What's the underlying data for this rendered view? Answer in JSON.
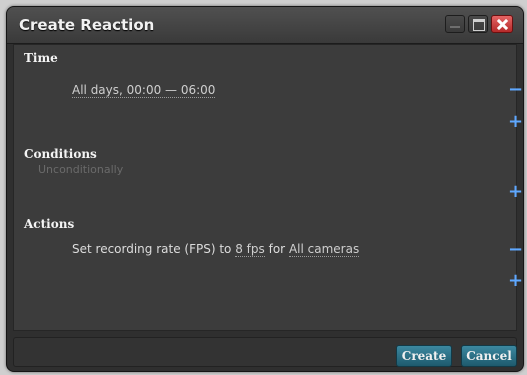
{
  "window": {
    "title": "Create Reaction"
  },
  "sections": {
    "time": {
      "title": "Time",
      "value": "All days, 00:00 — 06:00"
    },
    "conditions": {
      "title": "Conditions",
      "value": "Unconditionally"
    },
    "actions": {
      "title": "Actions",
      "prefix": "Set recording rate (FPS) to",
      "fps": "8 fps",
      "middle": "for",
      "cameras": "All cameras"
    }
  },
  "controls": {
    "minus": "−",
    "plus": "+"
  },
  "buttons": {
    "create": "Create",
    "cancel": "Cancel"
  }
}
